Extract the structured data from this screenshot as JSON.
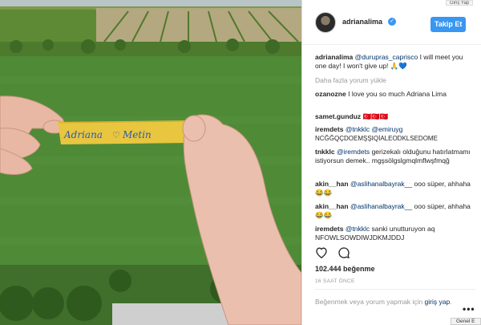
{
  "post": {
    "username": "adrianalima",
    "follow_label": "Takip Et",
    "photo_text": {
      "name1": "Adriana",
      "name2": "Metin"
    }
  },
  "comments": {
    "caption_user": "adrianalima",
    "caption_mention": "@durupras_caprisco",
    "caption_text": "I will meet you one day! I won't give up!",
    "load_more": "Daha fazla yorum yükle",
    "items": [
      {
        "user": "ozanozne",
        "text": "I love you so much Adriana Lima"
      },
      {
        "user": "samet.gunduz",
        "text": "🇹🇷🇹🇷🇹🇷"
      },
      {
        "user": "iremdets",
        "mention": "@tnkklc @emiruyg",
        "text": "NCĞĞQÇDOEMŞŞIQİALEODKLSEDOME"
      },
      {
        "user": "tnkklc",
        "mention": "@iremdets",
        "text": "gerizekalı olduğunu hatırlatmamı istiyorsun demek.. mgşsölgslgmqlmflwşfmqğ"
      },
      {
        "user": "akin__han",
        "mention": "@aslihanalbayrak__",
        "text": "ooo süper, ahhaha 😂😂"
      },
      {
        "user": "akin__han",
        "mention": "@aslihanalbayrak__",
        "text": "ooo süper, ahhaha 😂😂"
      },
      {
        "user": "iremdets",
        "mention": "@tnkklc",
        "text": "sanki unutturuyon aq NFOWLSOWDIWJDKMJDDJ"
      }
    ]
  },
  "stats": {
    "likes": "102.444 beğenme",
    "time": "16 SAAT ÖNCE"
  },
  "login_prompt": {
    "text": "Beğenmek veya yorum yapmak için",
    "link": "giriş yap",
    "suffix": "."
  },
  "more_options": "•••",
  "top_right_button": "Giriş Yap",
  "bottom_tab": "Genel E",
  "colors": {
    "accent": "#3897f0",
    "mention": "#003569",
    "grass": "#4f8a37",
    "tape": "#e8c640"
  }
}
